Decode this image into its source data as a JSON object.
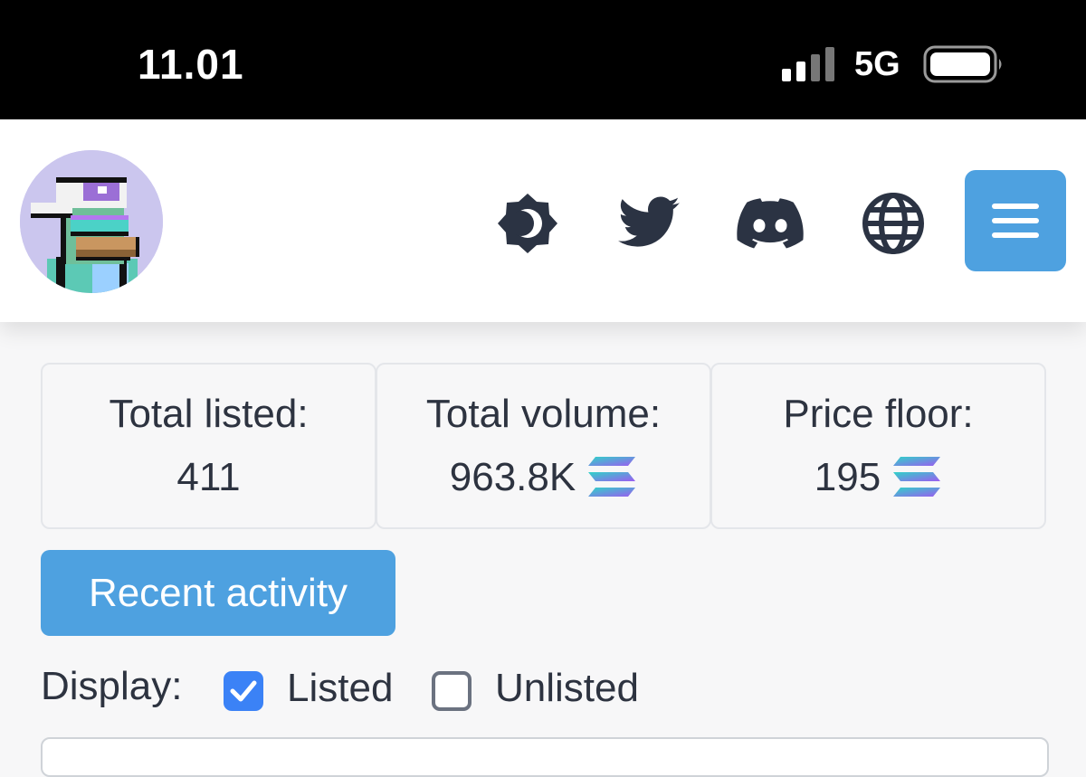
{
  "status_bar": {
    "time": "11.01",
    "network": "5G"
  },
  "header": {
    "icons": [
      "theme-toggle-icon",
      "twitter-icon",
      "discord-icon",
      "globe-icon",
      "menu-icon"
    ],
    "accent_color": "#4ea1e0"
  },
  "stats": {
    "total_listed_label": "Total listed:",
    "total_listed_value": "411",
    "total_volume_label": "Total volume:",
    "total_volume_value": "963.8K",
    "price_floor_label": "Price floor:",
    "price_floor_value": "195",
    "currency_icon": "solana-icon"
  },
  "recent_activity_label": "Recent activity",
  "display": {
    "label": "Display:",
    "options": [
      {
        "label": "Listed",
        "checked": true
      },
      {
        "label": "Unlisted",
        "checked": false
      }
    ]
  }
}
